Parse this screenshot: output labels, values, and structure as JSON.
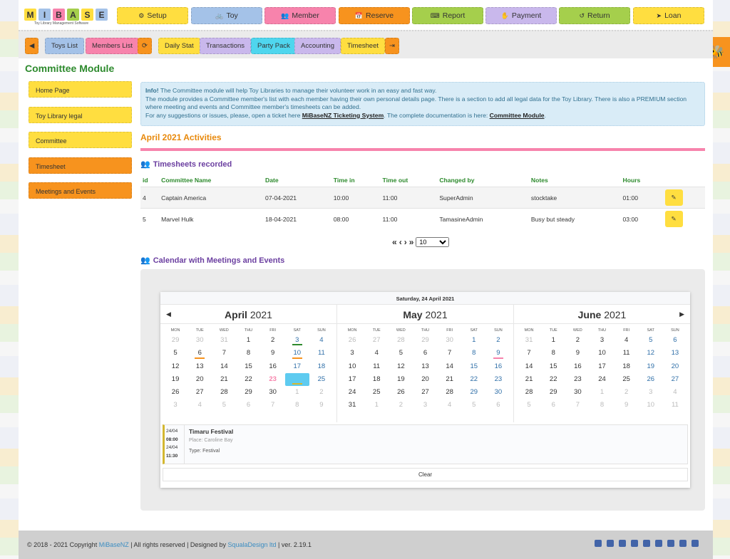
{
  "logo": {
    "letters": [
      "M",
      "I",
      "B",
      "A",
      "S",
      "E"
    ],
    "colors": [
      "#ffde40",
      "#a4c2e8",
      "#f783ac",
      "#a5cf4c",
      "#ffde40",
      "#a4c2e8"
    ],
    "subtitle": "Toy Library Management Software"
  },
  "top_nav": [
    {
      "label": "Setup",
      "icon": "gears-icon",
      "color": "#ffde40"
    },
    {
      "label": "Toy",
      "icon": "bicycle-icon",
      "color": "#a4c2e8"
    },
    {
      "label": "Member",
      "icon": "users-icon",
      "color": "#f783ac"
    },
    {
      "label": "Reserve",
      "icon": "calendar-plus-icon",
      "color": "#f7931e"
    },
    {
      "label": "Report",
      "icon": "keyboard-icon",
      "color": "#a5cf4c"
    },
    {
      "label": "Payment",
      "icon": "hand-coins-icon",
      "color": "#c9b8ec"
    },
    {
      "label": "Return",
      "icon": "undo-icon",
      "color": "#a5cf4c"
    },
    {
      "label": "Loan",
      "icon": "send-icon",
      "color": "#ffde40"
    }
  ],
  "toolbar": [
    {
      "label": "",
      "icon": "back-icon",
      "color": "#f7931e"
    },
    {
      "label": "Toys List",
      "color": "#a4c2e8"
    },
    {
      "label": "Members List",
      "color": "#f783ac"
    },
    {
      "label": "",
      "icon": "refresh-icon",
      "color": "#f7931e"
    },
    {
      "label": "Daily Stat",
      "color": "#ffde40"
    },
    {
      "label": "Transactions",
      "color": "#c9b8ec"
    },
    {
      "label": "Party Pack",
      "color": "#4fd6ee"
    },
    {
      "label": "Accounting",
      "color": "#c9b8ec"
    },
    {
      "label": "Timesheet",
      "color": "#ffde40"
    },
    {
      "label": "",
      "icon": "logout-icon",
      "color": "#f7931e"
    }
  ],
  "page_title": "Committee Module",
  "sidebar": [
    {
      "label": "Home Page",
      "color": "#ffde40"
    },
    {
      "label": "Toy Library legal",
      "color": "#ffde40"
    },
    {
      "label": "Committee",
      "color": "#ffde40"
    },
    {
      "label": "Timesheet",
      "color": "#f7931e"
    },
    {
      "label": "Meetings and Events",
      "color": "#f7931e"
    }
  ],
  "info": {
    "strong": "Info!",
    "line1": " The Committee module will help Toy Libraries to manage their volunteer work in an easy and fast way.",
    "line2": "The module provides a Committee member's list with each member having their own personal details page. There is a section to add all legal data for the Toy Library. There is also a PREMIUM section where meeting and events and Committee member's timesheets can be added.",
    "line3a": "For any suggestions or issues, please, open a ticket here ",
    "link1": "MiBaseNZ Ticketing System",
    "line3b": ". The complete documentation is here: ",
    "link2": "Committee Module",
    "line3c": "."
  },
  "activities_title": "April 2021 Activities",
  "timesheets": {
    "title": "Timesheets recorded",
    "columns": [
      "id",
      "Committee Name",
      "Date",
      "Time in",
      "Time out",
      "Changed by",
      "Notes",
      "Hours",
      ""
    ],
    "rows": [
      [
        "4",
        "Captain America",
        "07-04-2021",
        "10:00",
        "11:00",
        "SuperAdmin",
        "stocktake",
        "01:00"
      ],
      [
        "5",
        "Marvel Hulk",
        "18-04-2021",
        "08:00",
        "11:00",
        "TamasineAdmin",
        "Busy but steady",
        "03:00"
      ]
    ]
  },
  "pager": {
    "first": "«",
    "prev": "‹",
    "next": "›",
    "last": "»",
    "page_size": "10"
  },
  "calendar": {
    "title": "Calendar with Meetings and Events",
    "header": "Saturday, 24 April 2021",
    "dow": [
      "MON",
      "TUE",
      "WED",
      "THU",
      "FRI",
      "SAT",
      "SUN"
    ],
    "months": [
      {
        "name": "April",
        "year": "2021",
        "days": [
          29,
          30,
          31,
          1,
          2,
          3,
          4,
          5,
          6,
          7,
          8,
          9,
          10,
          11,
          12,
          13,
          14,
          15,
          16,
          17,
          18,
          19,
          20,
          21,
          22,
          23,
          24,
          25,
          26,
          27,
          28,
          29,
          30,
          1,
          2,
          3,
          4,
          5,
          6,
          7,
          8,
          9
        ],
        "lead": 3,
        "count": 30
      },
      {
        "name": "May",
        "year": "2021",
        "days": [
          26,
          27,
          28,
          29,
          30,
          1,
          2,
          3,
          4,
          5,
          6,
          7,
          8,
          9,
          10,
          11,
          12,
          13,
          14,
          15,
          16,
          17,
          18,
          19,
          20,
          21,
          22,
          23,
          24,
          25,
          26,
          27,
          28,
          29,
          30,
          31,
          1,
          2,
          3,
          4,
          5,
          6
        ],
        "lead": 5,
        "count": 31
      },
      {
        "name": "June",
        "year": "2021",
        "days": [
          31,
          1,
          2,
          3,
          4,
          5,
          6,
          7,
          8,
          9,
          10,
          11,
          12,
          13,
          14,
          15,
          16,
          17,
          18,
          19,
          20,
          21,
          22,
          23,
          24,
          25,
          26,
          27,
          28,
          29,
          30,
          1,
          2,
          3,
          4,
          5,
          6,
          7,
          8,
          9,
          10,
          11
        ],
        "lead": 1,
        "count": 30
      }
    ],
    "markers": [
      {
        "month": 0,
        "day": 3,
        "color": "#2d8a2d"
      },
      {
        "month": 0,
        "day": 6,
        "color": "#f7931e"
      },
      {
        "month": 0,
        "day": 10,
        "color": "#f7931e"
      },
      {
        "month": 1,
        "day": 9,
        "color": "#f783ac"
      },
      {
        "month": 0,
        "day": 24,
        "color": "#d4b830"
      }
    ],
    "selected": {
      "month": 0,
      "day": 24
    },
    "holiday": {
      "month": 0,
      "day": 23,
      "color": "#f783ac"
    },
    "event": {
      "start_date": "24/04",
      "start_time": "08:00",
      "end_date": "24/04",
      "end_time": "11:30",
      "title": "Timaru Festival",
      "place": "Place: Caroline Bay",
      "type": "Type: Festival"
    },
    "clear_label": "Clear"
  },
  "footer": {
    "pre": "© 2018 - 2021 Copyright ",
    "link1": "MiBaseNZ",
    "mid": " | All rights reserved | Designed by ",
    "link2": "SqualaDesign ltd",
    "post": " | ver. 2.19.1",
    "social": [
      "email-icon",
      "phone-icon",
      "web-icon",
      "facebook-icon",
      "twitter-icon",
      "youtube-icon",
      "flickr-icon",
      "instagram-icon",
      "linkedin-icon"
    ]
  }
}
